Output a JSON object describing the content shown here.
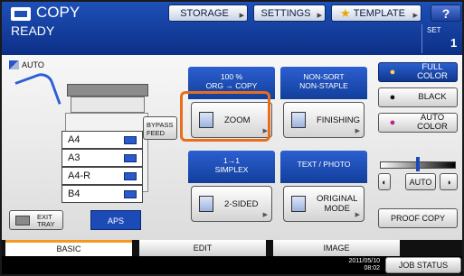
{
  "header": {
    "title": "COPY",
    "status": "READY",
    "set_label": "SET",
    "set_value": "1",
    "buttons": {
      "storage": "STORAGE",
      "settings": "SETTINGS",
      "template": "TEMPLATE",
      "help": "?"
    }
  },
  "left": {
    "auto_label": "AUTO",
    "trays": [
      "A4",
      "A3",
      "A4-R",
      "B4"
    ],
    "bypass_feed": "BYPASS FEED",
    "exit_tray": "EXIT TRAY",
    "aps": "APS"
  },
  "groups": {
    "zoom": {
      "label_line1": "100 %",
      "label_line2": "ORG → COPY",
      "button": "ZOOM"
    },
    "finishing": {
      "label_line1": "NON-SORT",
      "label_line2": "NON-STAPLE",
      "button": "FINISHING"
    },
    "sided": {
      "label_line1": "1→1",
      "label_line2": "SIMPLEX",
      "button": "2-SIDED"
    },
    "original": {
      "label_line1": "TEXT / PHOTO",
      "label_line2": "",
      "button_line1": "ORIGINAL",
      "button_line2": "MODE"
    }
  },
  "color": {
    "full": {
      "line1": "FULL",
      "line2": "COLOR"
    },
    "black": "BLACK",
    "auto": {
      "line1": "AUTO",
      "line2": "COLOR"
    }
  },
  "density": {
    "auto": "AUTO",
    "level": 0.5
  },
  "proof_copy": "PROOF COPY",
  "tabs": {
    "basic": "BASIC",
    "edit": "EDIT",
    "image": "IMAGE"
  },
  "footer": {
    "date": "2011/05/10",
    "time": "08:02",
    "job_status": "JOB STATUS"
  }
}
